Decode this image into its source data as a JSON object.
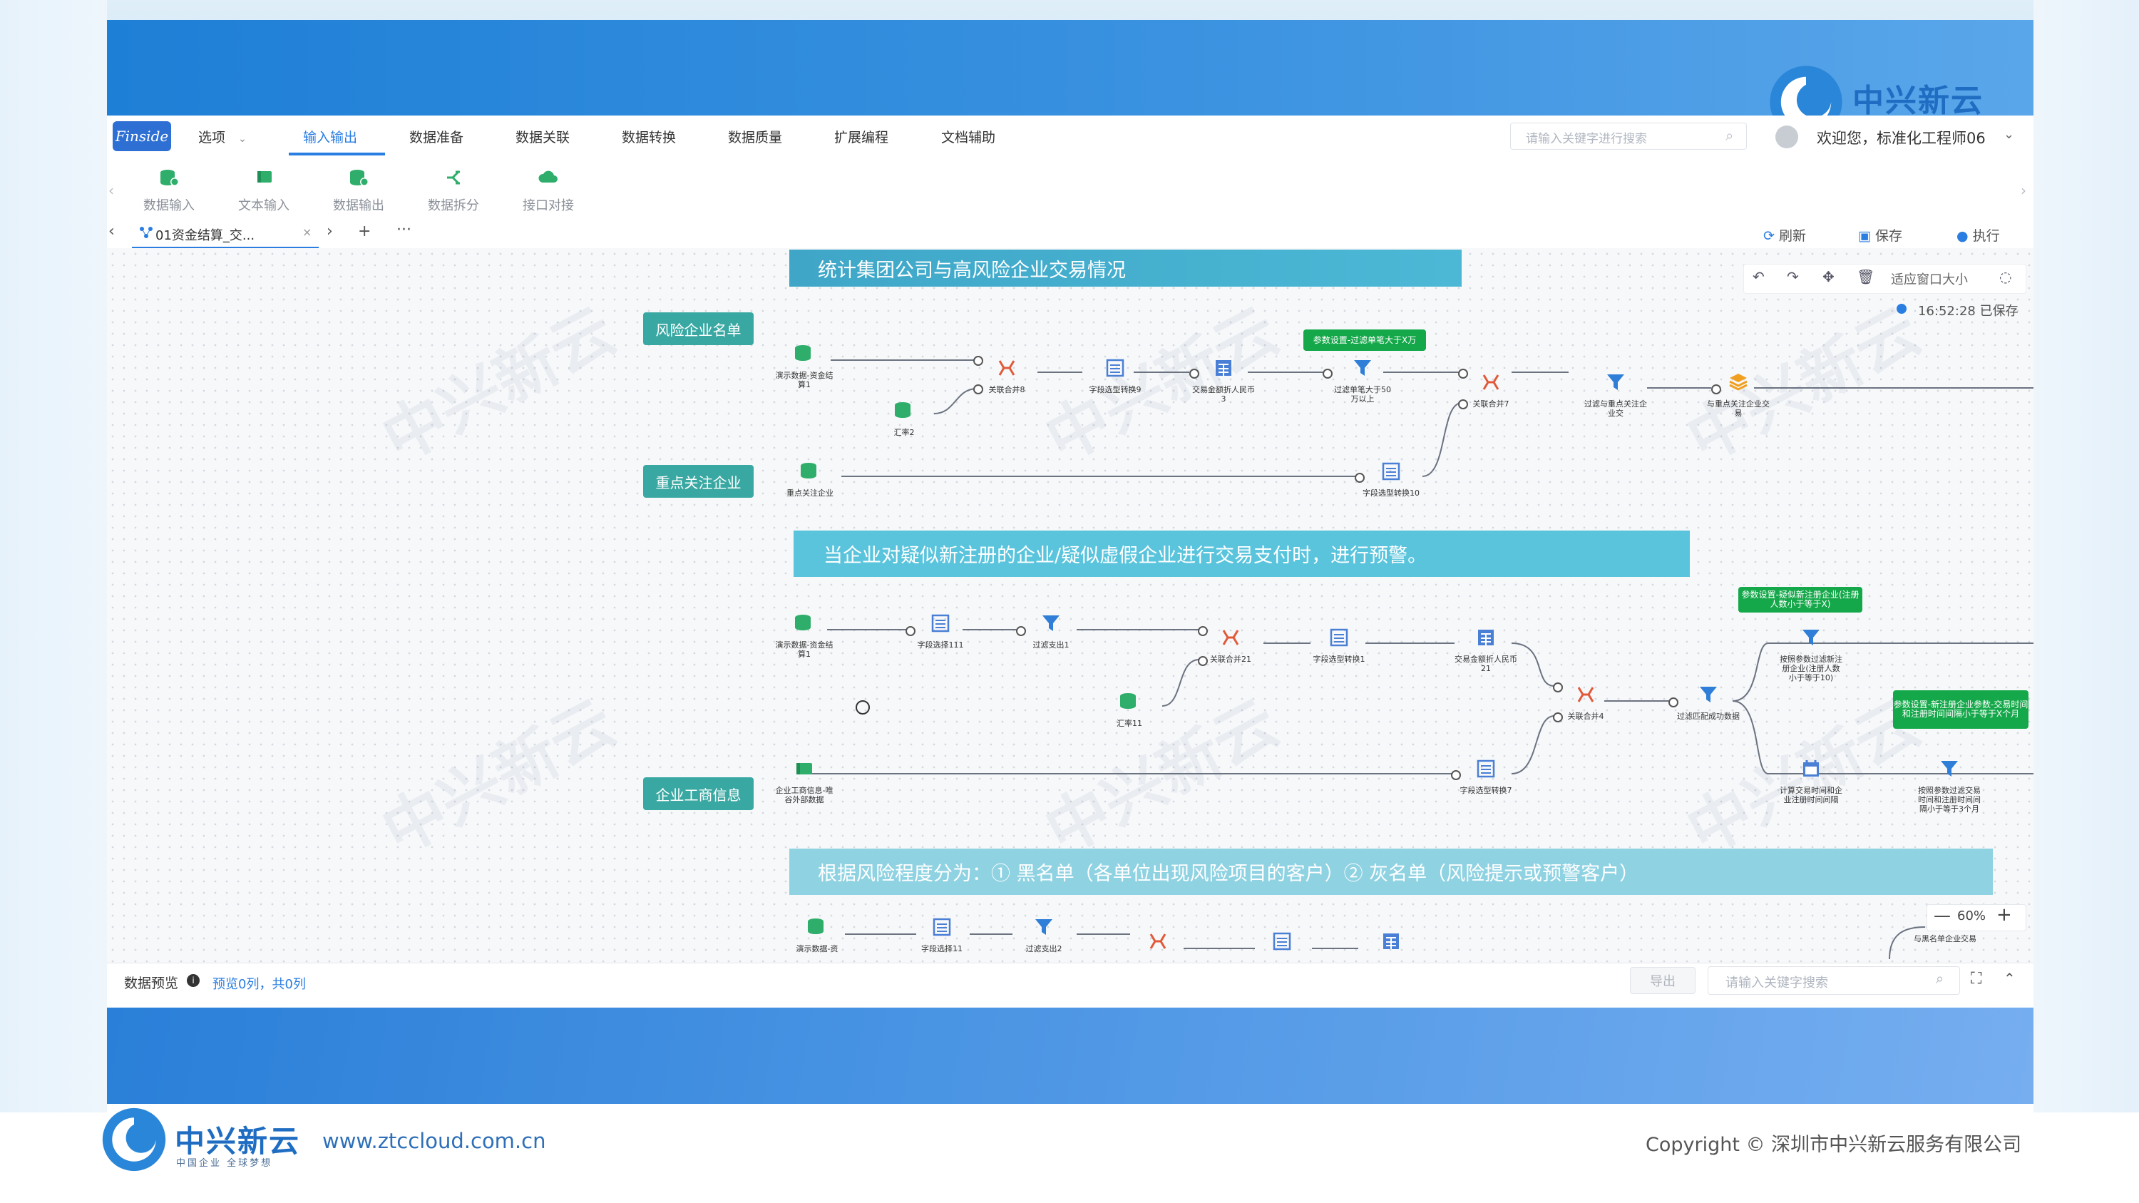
{
  "brand": {
    "name": "中兴新云",
    "tagline": "中国企业 全球梦想"
  },
  "app": {
    "logo": "Finside"
  },
  "menu": {
    "options": "选项",
    "items": [
      "输入输出",
      "数据准备",
      "数据关联",
      "数据转换",
      "数据质量",
      "扩展编程",
      "文档辅助"
    ],
    "search_placeholder": "请输入关键字进行搜索",
    "welcome": "欢迎您，标准化工程师06"
  },
  "ribbon": {
    "buttons": [
      "数据输入",
      "文本输入",
      "数据输出",
      "数据拆分",
      "接口对接"
    ]
  },
  "tabs": {
    "active": "01资金结算_交...",
    "close": "×",
    "add": "+",
    "more": "···",
    "prev": "‹",
    "next": "›"
  },
  "actions": {
    "refresh": "刷新",
    "save": "保存",
    "run": "执行"
  },
  "canvas": {
    "fit_window": "适应窗口大小",
    "saved_status": "16:52:28 已保存"
  },
  "banners": [
    "统计集团公司与高风险企业交易情况",
    "当企业对疑似新注册的企业/疑似虚假企业进行交易支付时，进行预警。",
    "根据风险程度分为：① 黑名单（各单位出现风险项目的客户）② 灰名单（风险提示或预警客户）"
  ],
  "groups": [
    "风险企业名单",
    "重点关注企业",
    "企业工商信息"
  ],
  "nodes": {
    "r1": [
      "演示数据-资金结算1",
      "汇率2",
      "关联合并8",
      "字段选型转换9",
      "交易金额折人民币3",
      "过滤单笔大于50万以上",
      "关联合并7",
      "过滤与重点关注企业交",
      "与重点关注企业交易"
    ],
    "r2": [
      "重点关注企业",
      "字段选型转换10"
    ],
    "r3": [
      "演示数据-资金结算1",
      "字段选择111",
      "过滤支出1",
      "关联合并21",
      "字段选型转换1",
      "交易金额折人民币21",
      "汇率11",
      "关联合并4",
      "过滤匹配成功数据",
      "企业工商信息-唯谷外部数据",
      "字段选型转换7",
      "按照参数过滤新注册企业(注册人数小于等于10)",
      "计算交易时间和企业注册时间间隔",
      "按照参数过滤交易时间和注册时间间隔小于等于3个月"
    ],
    "r4": [
      "演示数据-资",
      "字段选择11",
      "过滤支出2",
      "与黑名单企业交易"
    ]
  },
  "callouts": [
    "参数设置-过滤单笔大于X万",
    "参数设置-疑似新注册企业(注册人数小于等于X)",
    "参数设置-新注册企业参数-交易时间和注册时间间隔小于等于X个月"
  ],
  "zoom": {
    "value": "60%",
    "minus": "—",
    "plus": "+"
  },
  "preview": {
    "title": "数据预览",
    "info": "i",
    "count": "预览0列，共0列",
    "export": "导出",
    "search_placeholder": "请输入关键字搜索"
  },
  "footer": {
    "url": "www.ztccloud.com.cn",
    "copyright": "Copyright © 深圳市中兴新云服务有限公司"
  },
  "colors": {
    "accent": "#2a7de1",
    "banner": "#4cb8d6",
    "group": "#3aa8a2",
    "callout": "#15a84a"
  }
}
